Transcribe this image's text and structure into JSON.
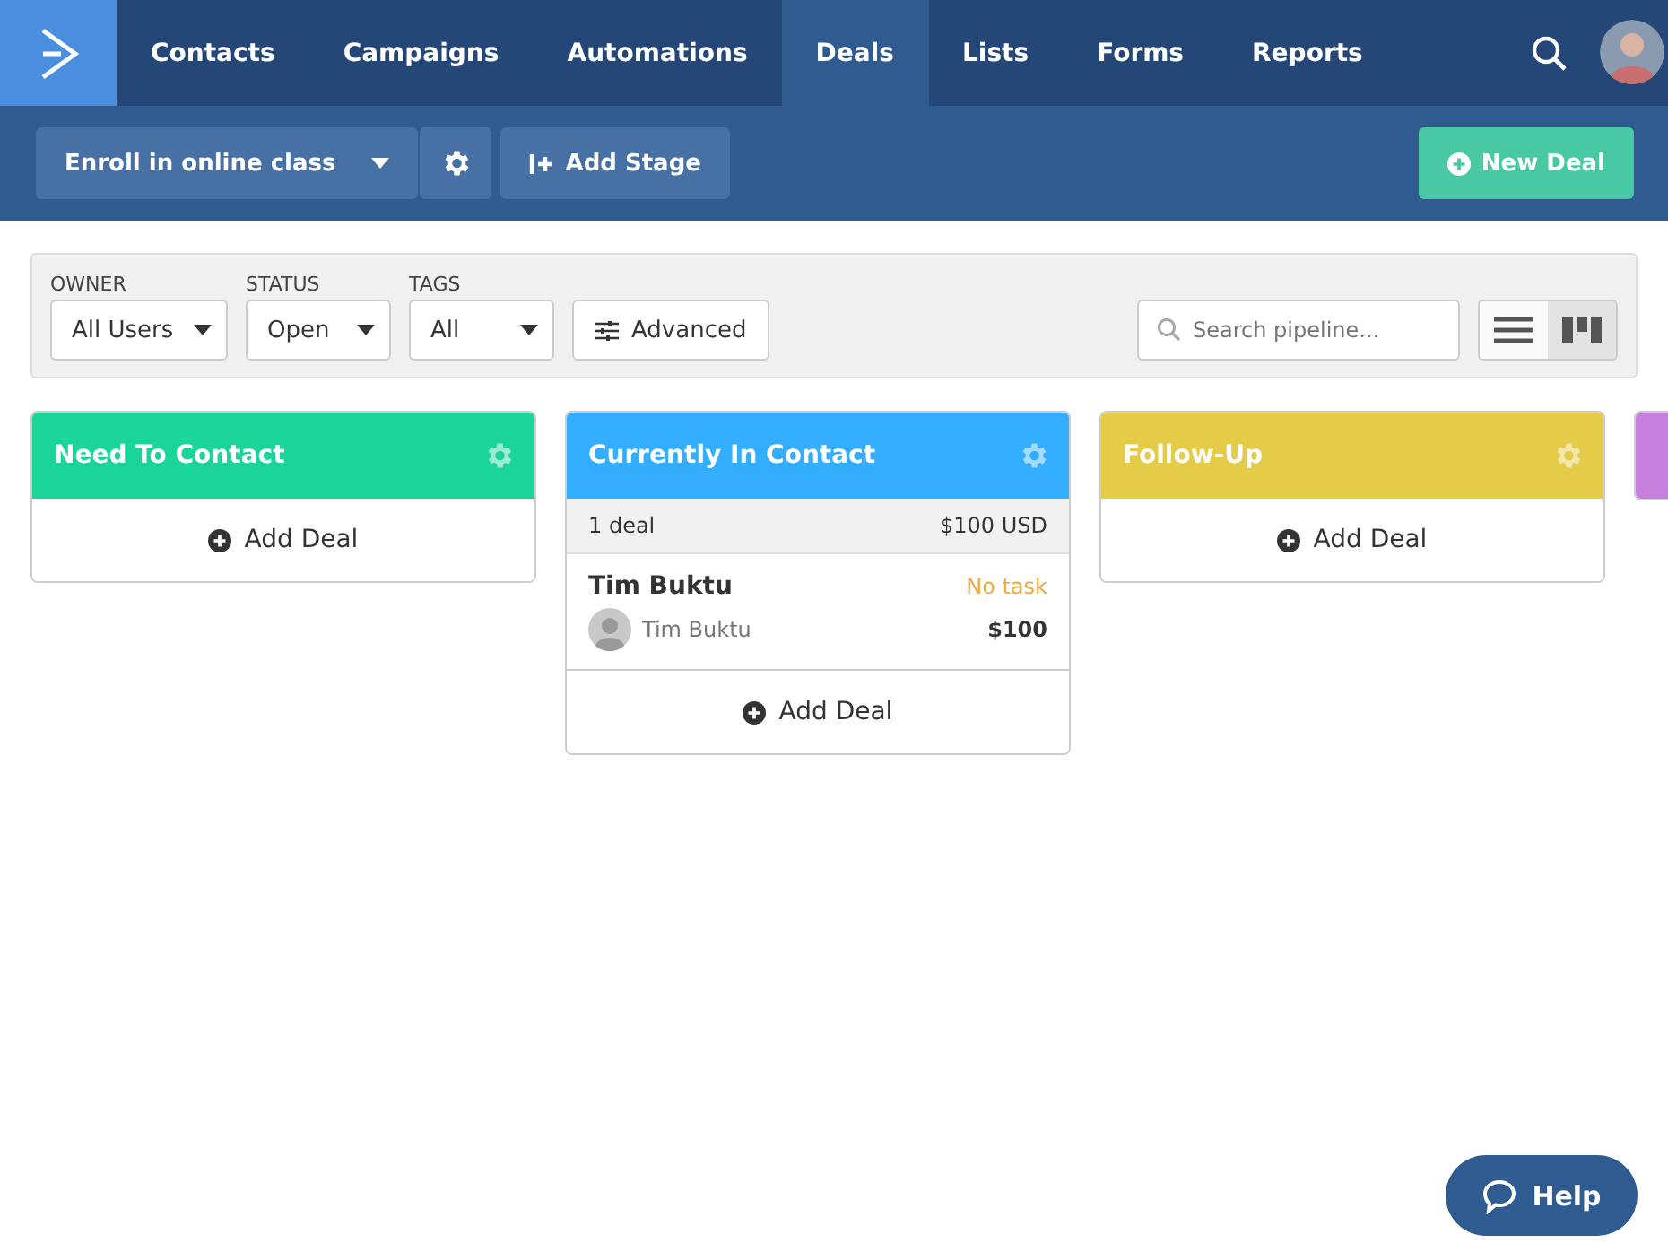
{
  "nav": {
    "items": [
      {
        "label": "Contacts",
        "selected": false
      },
      {
        "label": "Campaigns",
        "selected": false
      },
      {
        "label": "Automations",
        "selected": false
      },
      {
        "label": "Deals",
        "selected": true
      },
      {
        "label": "Lists",
        "selected": false
      },
      {
        "label": "Forms",
        "selected": false
      },
      {
        "label": "Reports",
        "selected": false
      }
    ]
  },
  "toolbar": {
    "pipeline": "Enroll in online class",
    "add_stage": "Add Stage",
    "new_deal": "New Deal"
  },
  "filters": [
    {
      "label": "OWNER",
      "value": "All Users"
    },
    {
      "label": "STATUS",
      "value": "Open"
    },
    {
      "label": "TAGS",
      "value": "All"
    }
  ],
  "advanced": "Advanced",
  "search": {
    "placeholder": "Search pipeline..."
  },
  "views": [
    {
      "kind": "list",
      "selected": false
    },
    {
      "kind": "board",
      "selected": true
    }
  ],
  "stages": [
    {
      "name": "Need To Contact",
      "color": "#1bd49a",
      "add_label": "Add Deal"
    },
    {
      "name": "Currently In Contact",
      "color": "#33adfd",
      "summary": {
        "count": "1 deal",
        "total": "$100 USD"
      },
      "deals": [
        {
          "title": "Tim Buktu",
          "task": "No task",
          "contact": "Tim Buktu",
          "value": "$100"
        }
      ],
      "add_label": "Add Deal"
    },
    {
      "name": "Follow-Up",
      "color": "#e5cc48",
      "add_label": "Add Deal"
    },
    {
      "color": "#c77fdd"
    }
  ],
  "help": "Help"
}
